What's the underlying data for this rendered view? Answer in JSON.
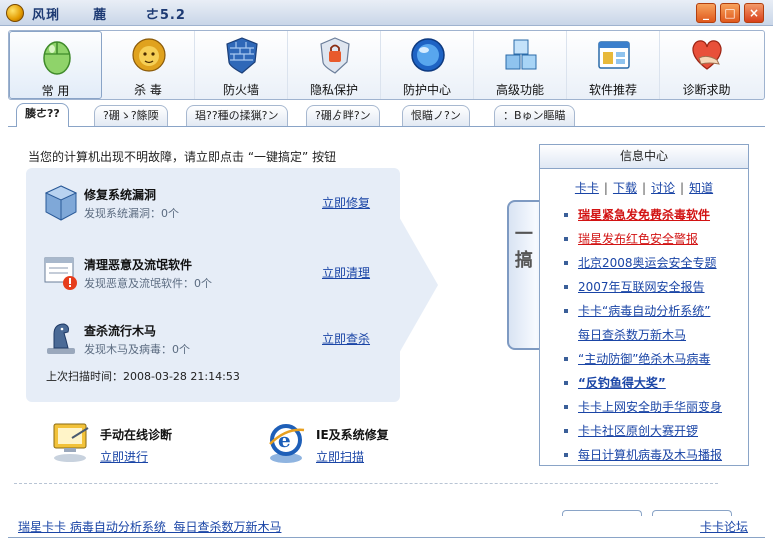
{
  "window": {
    "title": "风琍      蔍       ㄜ5.2",
    "min_label": "_",
    "max_label": "□",
    "close_label": "×"
  },
  "toolbar": {
    "items": [
      {
        "label": "常 用",
        "icon": "mouse-icon"
      },
      {
        "label": "杀 毒",
        "icon": "lion-icon"
      },
      {
        "label": "防火墙",
        "icon": "firewall-shield-icon"
      },
      {
        "label": "隐私保护",
        "icon": "privacy-lock-icon"
      },
      {
        "label": "防护中心",
        "icon": "protection-globe-icon"
      },
      {
        "label": "高级功能",
        "icon": "cubes-icon"
      },
      {
        "label": "软件推荐",
        "icon": "software-window-icon"
      },
      {
        "label": "诊断求助",
        "icon": "heart-hand-icon"
      }
    ]
  },
  "tabs": [
    "腠ㄜ??",
    "?硼ゝ?篨陾",
    "琩??種の揉猟?ン",
    "?硼ゟ眫?ン",
    "恨瞄ノ?ン",
    "：Bゅン瞘瞄"
  ],
  "main": {
    "notice": "当您的计算机出现不明故障，请立即点击 “一键搞定” 按钮",
    "items": [
      {
        "title": "修复系统漏洞",
        "status": "发现系统漏洞：0个",
        "action": "立即修复"
      },
      {
        "title": "清理恶意及流氓软件",
        "status": "发现恶意及流氓软件：0个",
        "action": "立即清理"
      },
      {
        "title": "查杀流行木马",
        "status": "发现木马及病毒：0个",
        "action": "立即查杀"
      }
    ],
    "last_scan": "上次扫描时间：2008-03-28  21:14:53",
    "onekey_label": "一 键 搞 定",
    "diagnose": {
      "title": "手动在线诊断",
      "action": "立即进行"
    },
    "ie_repair": {
      "title": "IE及系统修复",
      "action": "立即扫描"
    }
  },
  "info": {
    "title": "信息中心",
    "nav": [
      "卡卡",
      "下载",
      "讨论",
      "知道"
    ],
    "news": [
      {
        "text": "瑞星紧急发免费杀毒软件",
        "style": "red-bold"
      },
      {
        "text": "瑞星发布红色安全警报",
        "style": "red"
      },
      {
        "text": "北京2008奥运会安全专题",
        "style": "normal"
      },
      {
        "text": "2007年互联网安全报告",
        "style": "normal"
      },
      {
        "text": "卡卡“病毒自动分析系统”",
        "style": "normal"
      },
      {
        "text": "每日查杀数万新木马",
        "style": "normal"
      },
      {
        "text": "“主动防御”绝杀木马病毒",
        "style": "normal"
      },
      {
        "text": "“反钓鱼得大奖”",
        "style": "bold"
      },
      {
        "text": "卡卡上网安全助手华丽变身",
        "style": "normal"
      },
      {
        "text": "卡卡社区原创大赛开锣",
        "style": "normal"
      },
      {
        "text": "每日计算机病毒及木马播报",
        "style": "normal"
      }
    ]
  },
  "status": {
    "left": "瑞星卡卡 病毒自动分析系统  每日查杀数万新木马",
    "right": "卡卡论坛"
  },
  "colors": {
    "accent": "#1a45a6",
    "alert": "#d21313",
    "panel": "#e6edf7",
    "border": "#8aa4c7"
  }
}
